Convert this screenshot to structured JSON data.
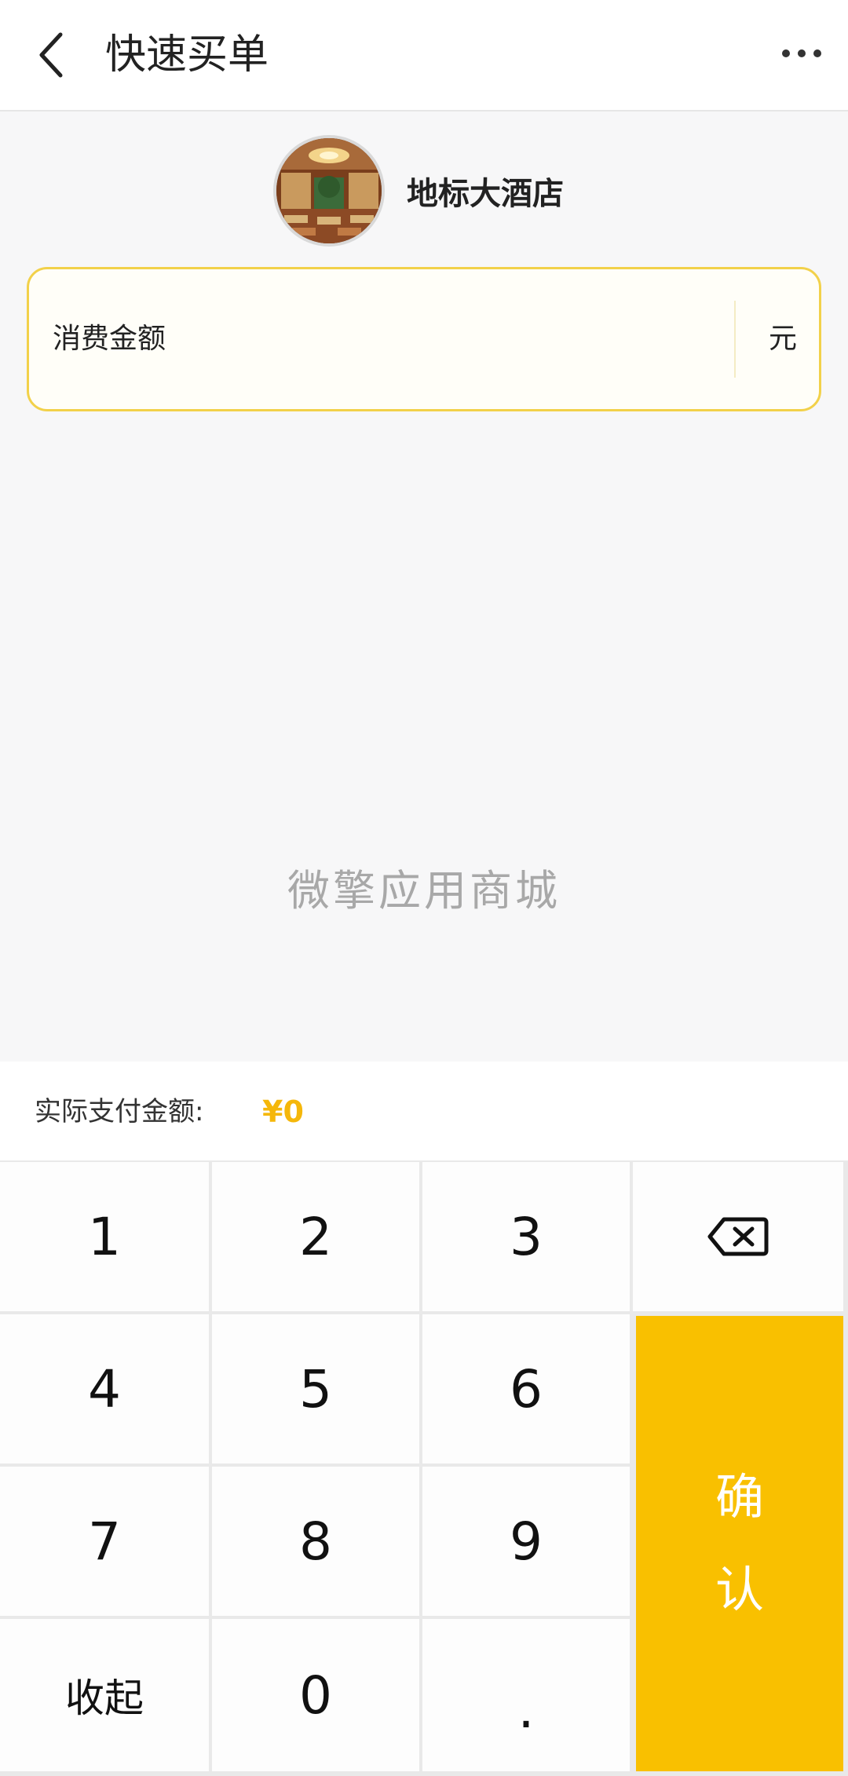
{
  "header": {
    "title": "快速买单",
    "back_icon": "chevron-left-icon",
    "more_icon": "more-dots-icon"
  },
  "store": {
    "name": "地标大酒店",
    "avatar_icon": "store-photo"
  },
  "amount": {
    "label": "消费金额",
    "value": "",
    "unit": "元"
  },
  "watermark": "微擎应用商城",
  "pay": {
    "label": "实际支付金额:",
    "amount": "¥0",
    "accent_color": "#f5b70a"
  },
  "keypad": {
    "keys": [
      "1",
      "2",
      "3",
      "4",
      "5",
      "6",
      "7",
      "8",
      "9",
      "0",
      "."
    ],
    "collapse_label": "收起",
    "backspace_icon": "backspace-icon",
    "confirm_chars": [
      "确",
      "认"
    ],
    "confirm_color": "#f9c000"
  }
}
